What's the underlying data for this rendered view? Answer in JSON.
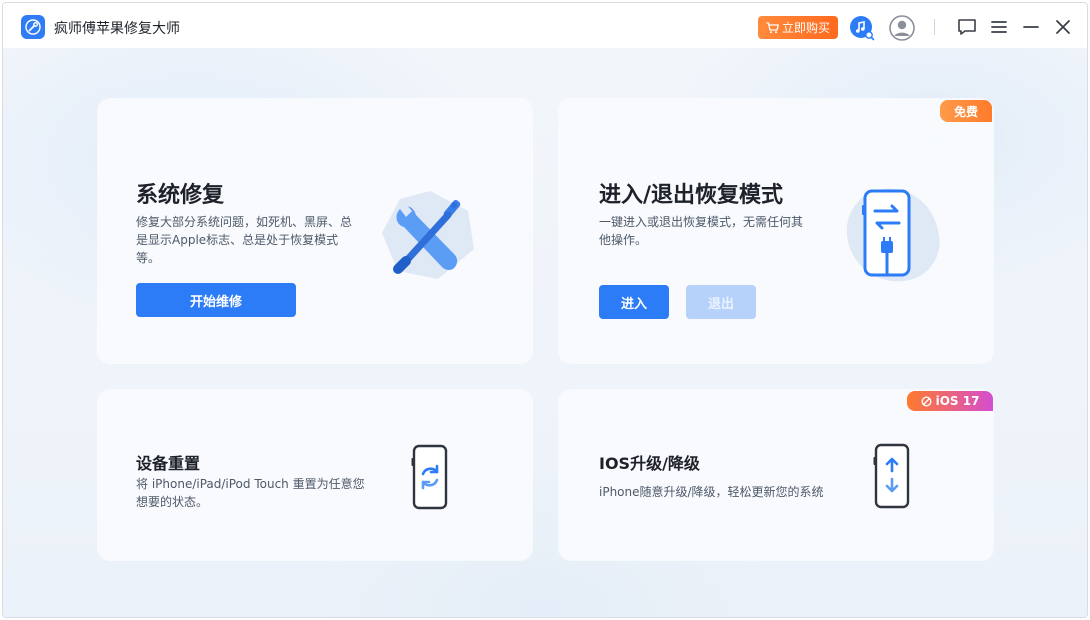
{
  "app": {
    "title": "疯师傅苹果修复大师",
    "buy_label": "立即购买"
  },
  "titlebar": {
    "icons": [
      "app-logo-icon",
      "music-search-icon",
      "avatar-icon",
      "feedback-icon",
      "menu-icon",
      "minimize-icon",
      "close-icon"
    ]
  },
  "colors": {
    "accent": "#2b7cf6",
    "accent_disabled": "#b6d2fb",
    "buy": "#ff6a1e",
    "badge_free": "#ff8a3c",
    "badge_ios_start": "#ff7a2e",
    "badge_ios_end": "#d44dd0"
  },
  "cards": {
    "system_repair": {
      "title": "系统修复",
      "desc": "修复大部分系统问题，如死机、黑屏、总是显示Apple标志、总是处于恢复模式等。",
      "button": "开始维修",
      "icon": "wrench-screwdriver-icon"
    },
    "recovery_mode": {
      "title": "进入/退出恢复模式",
      "desc": "一键进入或退出恢复模式，无需任何其他操作。",
      "badge": "免费",
      "enter_button": "进入",
      "exit_button": "退出",
      "icon": "phone-transfer-icon"
    },
    "device_reset": {
      "title": "设备重置",
      "desc": "将 iPhone/iPad/iPod Touch 重置为任意您想要的状态。",
      "icon": "phone-reset-icon"
    },
    "ios_upgrade": {
      "title": "IOS升级/降级",
      "desc": "iPhone随意升级/降级，轻松更新您的系统",
      "badge": "iOS 17",
      "icon": "phone-updown-icon"
    }
  }
}
